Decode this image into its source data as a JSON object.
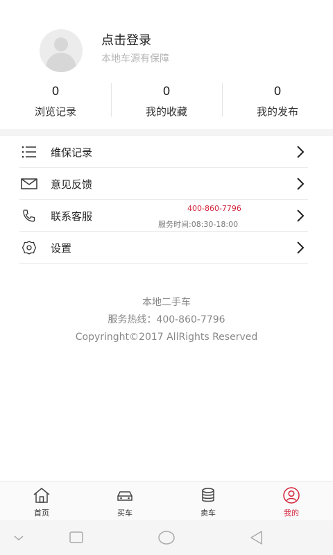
{
  "profile": {
    "login_title": "点击登录",
    "login_subtitle": "本地车源有保障",
    "avatar_icon": "user-placeholder-icon"
  },
  "stats": [
    {
      "value": "0",
      "label": "浏览记录"
    },
    {
      "value": "0",
      "label": "我的收藏"
    },
    {
      "value": "0",
      "label": "我的发布"
    }
  ],
  "menu": {
    "items": [
      {
        "label": "维保记录",
        "icon": "list-icon"
      },
      {
        "label": "意见反馈",
        "icon": "mail-icon"
      },
      {
        "label": "联系客服",
        "icon": "phone-icon",
        "phone": "400-860-7796",
        "hours": "服务时间:08:30-18:00"
      },
      {
        "label": "设置",
        "icon": "gear-icon"
      }
    ]
  },
  "footer_info": {
    "name": "本地二手车",
    "hotline": "服务热线：400-860-7796",
    "copyright": "Copyringht©2017 AllRights Reserved"
  },
  "tabbar": {
    "tabs": [
      {
        "label": "首页",
        "icon": "home-icon",
        "active": false
      },
      {
        "label": "买车",
        "icon": "car-icon",
        "active": false
      },
      {
        "label": "卖车",
        "icon": "database-icon",
        "active": false
      },
      {
        "label": "我的",
        "icon": "user-circle-icon",
        "active": true
      }
    ]
  },
  "colors": {
    "accent": "#d4213a",
    "background": "#ffffff",
    "divider": "#ececec"
  }
}
